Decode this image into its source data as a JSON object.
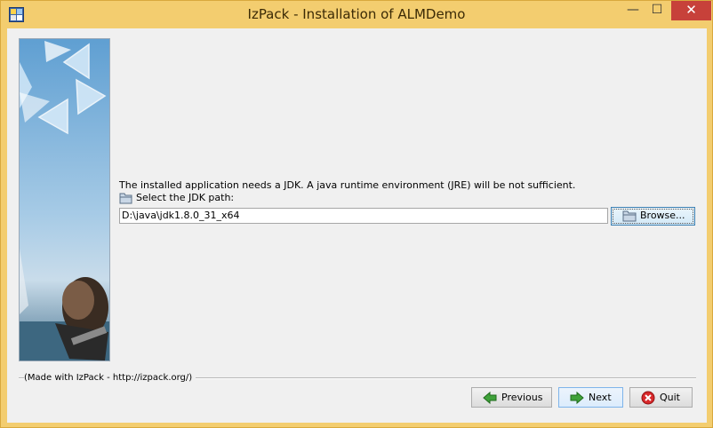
{
  "window": {
    "title": "IzPack - Installation of ALMDemo",
    "minimize_glyph": "—",
    "maximize_glyph": "☐",
    "close_glyph": "✕"
  },
  "panel": {
    "intro_text": "The installed application needs a JDK. A java runtime environment (JRE) will be not sufficient.",
    "jdk_label": "Select the JDK path:",
    "jdk_path_value": "D:\\java\\jdk1.8.0_31_x64",
    "browse_label": "Browse..."
  },
  "footer": {
    "made_with": "(Made with IzPack - http://izpack.org/)",
    "previous_label": "Previous",
    "next_label": "Next",
    "quit_label": "Quit"
  },
  "icons": {
    "app": "izpack-app-icon",
    "folder": "folder-icon",
    "previous": "arrow-left-icon",
    "next": "arrow-right-icon",
    "quit": "quit-icon"
  },
  "colors": {
    "title_bar": "#f3cd6f",
    "close_button": "#c7413a",
    "arrow_green": "#3fa23a",
    "quit_red": "#d8282a"
  }
}
